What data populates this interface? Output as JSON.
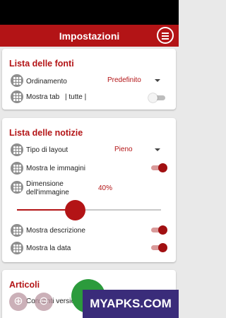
{
  "app_bar": {
    "title": "Impostazioni",
    "icon": "menu-icon"
  },
  "sources": {
    "title": "Lista delle fonti",
    "sort_label": "Ordinamento",
    "sort_value": "Predefinito",
    "show_tab_label": "Mostra tab",
    "show_tab_value": "| tutte |",
    "show_tab_on": false
  },
  "news": {
    "title": "Lista delle notizie",
    "layout_label": "Tipo di layout",
    "layout_value": "Pieno",
    "show_images_label": "Mostra le immagini",
    "show_images_on": true,
    "image_size_label_line1": "Dimensione",
    "image_size_label_line2": "dell'immagine",
    "image_size_value": "40%",
    "image_size_level": 0.4,
    "show_description_label": "Mostra descrizione",
    "show_description_on": true,
    "show_date_label": "Mostra la data",
    "show_date_on": true
  },
  "articles": {
    "title": "Articoli",
    "allow_label": "Consenti versio"
  },
  "overlay": {
    "fab_icon": "chevron-down-icon",
    "zoom_in_icon": "zoom-in-icon",
    "zoom_out_icon": "zoom-out-icon",
    "watermark": "MYAPKS.COM"
  },
  "colors": {
    "accent": "#b31416",
    "fab": "#2c9b3c",
    "watermark_bg": "#3a2c7a"
  }
}
